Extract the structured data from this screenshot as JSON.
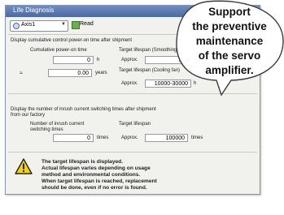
{
  "window": {
    "title": "Life Diagnosis"
  },
  "toolbar": {
    "axis_select": "Axis1",
    "read_label": "Read"
  },
  "power_on": {
    "heading": "Display cumulative control power-on time after shipment",
    "cumulative_label": "Cumulative power-on time",
    "hours_value": "0",
    "hours_unit": "h",
    "approx_symbol": "≈",
    "years_value": "0.00",
    "years_unit": "years",
    "lifespan_cap_label": "Target lifespan (Smoothing capacitor)",
    "approx_label": "Approx.",
    "cap_value": "10",
    "cap_unit": "years",
    "lifespan_fan_label": "Target lifespan (Cooling fan)",
    "fan_value": "10000-30000",
    "fan_unit": "h"
  },
  "inrush": {
    "heading_line1": "Display the number of inrush current switching times after shipment",
    "heading_line2": "from our factory",
    "count_label_line1": "Number of inrush current",
    "count_label_line2": "switching times",
    "count_value": "0",
    "count_unit": "times",
    "target_label": "Target lifespan",
    "approx_label": "Approx.",
    "target_value": "100000",
    "target_unit": "times"
  },
  "warning": {
    "line1": "The target lifespan is displayed.",
    "line2": "Actual lifespan varies depending on usage",
    "line3": "method and environmental conditions.",
    "line4": "When target lifespan is reached, replacement",
    "line5": "should be done, even if no error is found."
  },
  "callout": {
    "line1": "Support",
    "line2": "the preventive",
    "line3": "maintenance",
    "line4": "of the servo",
    "line5": "amplifier."
  },
  "colors": {
    "titlebar": "#5a78b0",
    "window_bg": "#f1f1ee",
    "warning_yellow": "#f4d20c"
  }
}
